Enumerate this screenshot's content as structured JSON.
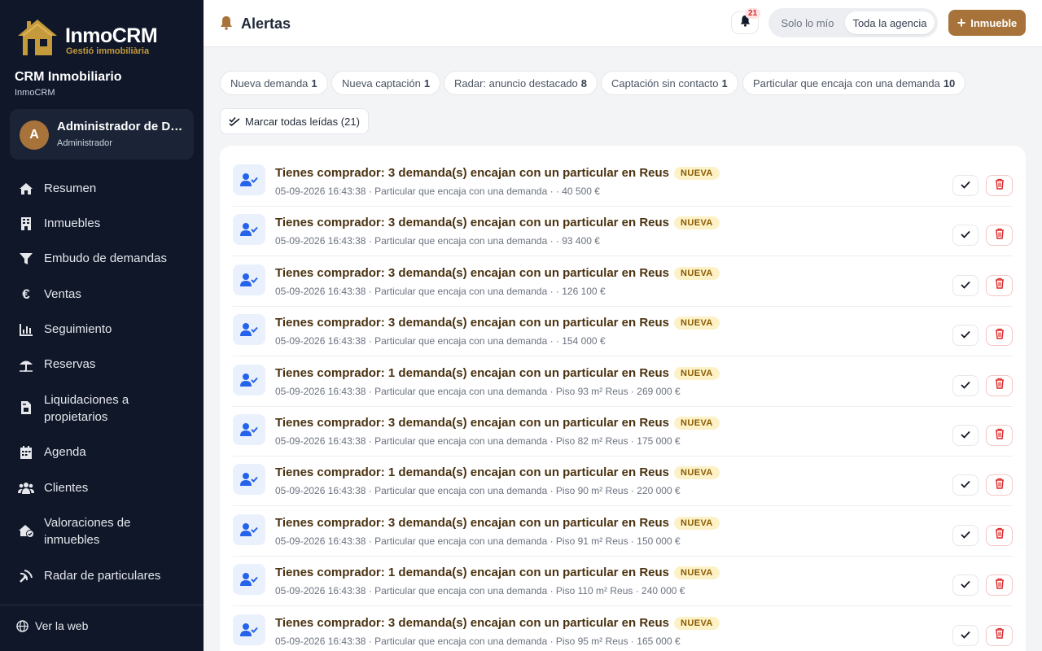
{
  "brand": {
    "logo_title": "InmoCRM",
    "logo_subtitle": "Gestió immobiliària",
    "crm_title": "CRM Inmobiliario",
    "crm_subtitle": "InmoCRM"
  },
  "user": {
    "initial": "A",
    "name": "Administrador de Demo",
    "role": "Administrador"
  },
  "sidebar": {
    "items": [
      {
        "label": "Resumen",
        "icon": "home-icon"
      },
      {
        "label": "Inmuebles",
        "icon": "building-icon"
      },
      {
        "label": "Embudo de demandas",
        "icon": "filter-icon"
      },
      {
        "label": "Ventas",
        "icon": "euro-icon"
      },
      {
        "label": "Seguimiento",
        "icon": "chart-icon"
      },
      {
        "label": "Reservas",
        "icon": "umbrella-icon"
      },
      {
        "label": "Liquidaciones a propietarios",
        "icon": "file-invoice-icon"
      },
      {
        "label": "Agenda",
        "icon": "calendar-icon"
      },
      {
        "label": "Clientes",
        "icon": "users-icon"
      },
      {
        "label": "Valoraciones de inmuebles",
        "icon": "house-check-icon"
      },
      {
        "label": "Radar de particulares",
        "icon": "radar-icon"
      }
    ],
    "footer_link": "Ver la web"
  },
  "header": {
    "title": "Alertas",
    "notification_count": "21",
    "scope_options": [
      "Solo lo mío",
      "Toda la agencia"
    ],
    "scope_selected": "Toda la agencia",
    "add_button": "Inmueble"
  },
  "filters": [
    {
      "label": "Nueva demanda",
      "count": "1"
    },
    {
      "label": "Nueva captación",
      "count": "1"
    },
    {
      "label": "Radar: anuncio destacado",
      "count": "8"
    },
    {
      "label": "Captación sin contacto",
      "count": "1"
    },
    {
      "label": "Particular que encaja con una demanda",
      "count": "10"
    }
  ],
  "mark_all_label": "Marcar todas leídas (21)",
  "alerts": [
    {
      "title": "Tienes comprador: 3 demanda(s) encajan con un particular en Reus",
      "badge": "NUEVA",
      "meta": "05-09-2026 16:43:38 · Particular que encaja con una demanda · · 40 500 €"
    },
    {
      "title": "Tienes comprador: 3 demanda(s) encajan con un particular en Reus",
      "badge": "NUEVA",
      "meta": "05-09-2026 16:43:38 · Particular que encaja con una demanda · · 93 400 €"
    },
    {
      "title": "Tienes comprador: 3 demanda(s) encajan con un particular en Reus",
      "badge": "NUEVA",
      "meta": "05-09-2026 16:43:38 · Particular que encaja con una demanda · · 126 100 €"
    },
    {
      "title": "Tienes comprador: 3 demanda(s) encajan con un particular en Reus",
      "badge": "NUEVA",
      "meta": "05-09-2026 16:43:38 · Particular que encaja con una demanda · · 154 000 €"
    },
    {
      "title": "Tienes comprador: 1 demanda(s) encajan con un particular en Reus",
      "badge": "NUEVA",
      "meta": "05-09-2026 16:43:38 · Particular que encaja con una demanda · Piso 93 m² Reus · 269 000 €"
    },
    {
      "title": "Tienes comprador: 3 demanda(s) encajan con un particular en Reus",
      "badge": "NUEVA",
      "meta": "05-09-2026 16:43:38 · Particular que encaja con una demanda · Piso 82 m² Reus · 175 000 €"
    },
    {
      "title": "Tienes comprador: 1 demanda(s) encajan con un particular en Reus",
      "badge": "NUEVA",
      "meta": "05-09-2026 16:43:38 · Particular que encaja con una demanda · Piso 90 m² Reus · 220 000 €"
    },
    {
      "title": "Tienes comprador: 3 demanda(s) encajan con un particular en Reus",
      "badge": "NUEVA",
      "meta": "05-09-2026 16:43:38 · Particular que encaja con una demanda · Piso 91 m² Reus · 150 000 €"
    },
    {
      "title": "Tienes comprador: 1 demanda(s) encajan con un particular en Reus",
      "badge": "NUEVA",
      "meta": "05-09-2026 16:43:38 · Particular que encaja con una demanda · Piso 110 m² Reus · 240 000 €"
    },
    {
      "title": "Tienes comprador: 3 demanda(s) encajan con un particular en Reus",
      "badge": "NUEVA",
      "meta": "05-09-2026 16:43:38 · Particular que encaja con una demanda · Piso 95 m² Reus · 165 000 €"
    }
  ],
  "colors": {
    "sidebar_bg": "#0f1729",
    "accent": "#a8733a",
    "title_text": "#4a3210",
    "badge_bg": "#fdf1c7",
    "delete_red": "#dc2626",
    "icon_blue": "#2563eb"
  }
}
